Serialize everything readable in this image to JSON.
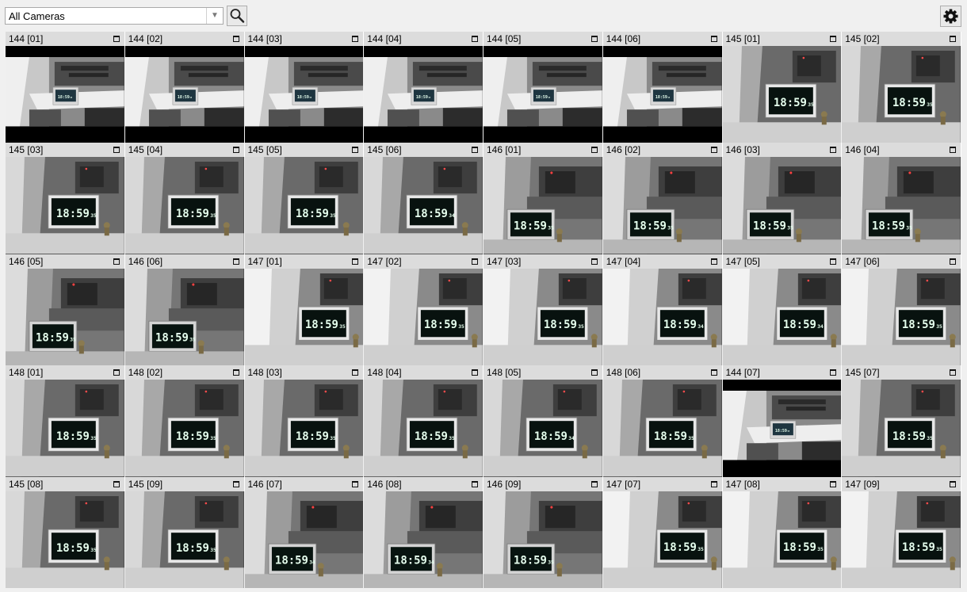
{
  "toolbar": {
    "camera_filter": {
      "selected": "All Cameras"
    },
    "search_icon": "magnifier-icon",
    "settings_icon": "gear-icon"
  },
  "clock_text": "18:59",
  "grid": {
    "columns": 8,
    "rows": 5,
    "tiles": [
      {
        "label": "144 [01]",
        "seconds": "35",
        "scene": "a"
      },
      {
        "label": "144 [02]",
        "seconds": "35",
        "scene": "a"
      },
      {
        "label": "144 [03]",
        "seconds": "35",
        "scene": "a"
      },
      {
        "label": "144 [04]",
        "seconds": "35",
        "scene": "a"
      },
      {
        "label": "144 [05]",
        "seconds": "35",
        "scene": "a"
      },
      {
        "label": "144 [06]",
        "seconds": "35",
        "scene": "a"
      },
      {
        "label": "145 [01]",
        "seconds": "35",
        "scene": "b"
      },
      {
        "label": "145 [02]",
        "seconds": "35",
        "scene": "b"
      },
      {
        "label": "145 [03]",
        "seconds": "35",
        "scene": "b"
      },
      {
        "label": "145 [04]",
        "seconds": "35",
        "scene": "b"
      },
      {
        "label": "145 [05]",
        "seconds": "35",
        "scene": "b"
      },
      {
        "label": "145 [06]",
        "seconds": "34",
        "scene": "b"
      },
      {
        "label": "146 [01]",
        "seconds": "35",
        "scene": "c"
      },
      {
        "label": "146 [02]",
        "seconds": "35",
        "scene": "c"
      },
      {
        "label": "146 [03]",
        "seconds": "35",
        "scene": "c"
      },
      {
        "label": "146 [04]",
        "seconds": "35",
        "scene": "c"
      },
      {
        "label": "146 [05]",
        "seconds": "35",
        "scene": "c"
      },
      {
        "label": "146 [06]",
        "seconds": "35",
        "scene": "c"
      },
      {
        "label": "147 [01]",
        "seconds": "35",
        "scene": "d"
      },
      {
        "label": "147 [02]",
        "seconds": "35",
        "scene": "d"
      },
      {
        "label": "147 [03]",
        "seconds": "35",
        "scene": "d"
      },
      {
        "label": "147 [04]",
        "seconds": "34",
        "scene": "d"
      },
      {
        "label": "147 [05]",
        "seconds": "34",
        "scene": "d"
      },
      {
        "label": "147 [06]",
        "seconds": "35",
        "scene": "d"
      },
      {
        "label": "148 [01]",
        "seconds": "35",
        "scene": "b"
      },
      {
        "label": "148 [02]",
        "seconds": "35",
        "scene": "b"
      },
      {
        "label": "148 [03]",
        "seconds": "35",
        "scene": "b"
      },
      {
        "label": "148 [04]",
        "seconds": "35",
        "scene": "b"
      },
      {
        "label": "148 [05]",
        "seconds": "34",
        "scene": "b"
      },
      {
        "label": "148 [06]",
        "seconds": "35",
        "scene": "b"
      },
      {
        "label": "144 [07]",
        "seconds": "35",
        "scene": "a"
      },
      {
        "label": "145 [07]",
        "seconds": "35",
        "scene": "b"
      },
      {
        "label": "145 [08]",
        "seconds": "35",
        "scene": "b"
      },
      {
        "label": "145 [09]",
        "seconds": "35",
        "scene": "b"
      },
      {
        "label": "146 [07]",
        "seconds": "34",
        "scene": "c"
      },
      {
        "label": "146 [08]",
        "seconds": "34",
        "scene": "c"
      },
      {
        "label": "146 [09]",
        "seconds": "35",
        "scene": "c"
      },
      {
        "label": "147 [07]",
        "seconds": "35",
        "scene": "d"
      },
      {
        "label": "147 [08]",
        "seconds": "35",
        "scene": "d"
      },
      {
        "label": "147 [09]",
        "seconds": "35",
        "scene": "d"
      }
    ]
  }
}
